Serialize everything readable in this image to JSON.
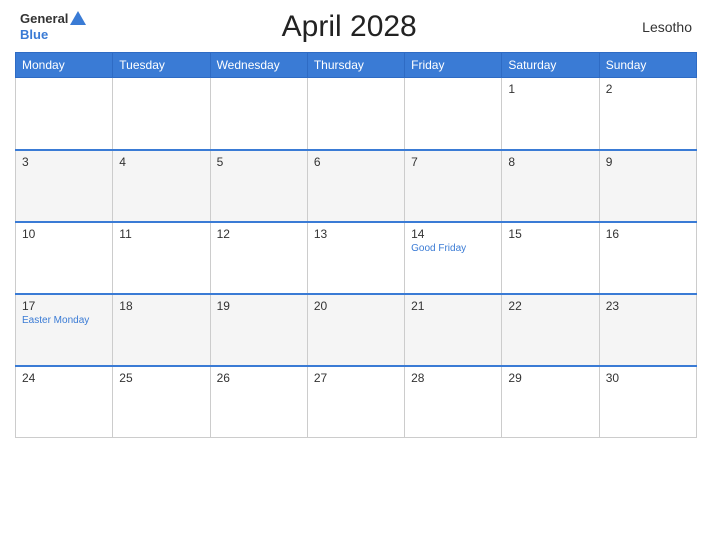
{
  "header": {
    "title": "April 2028",
    "country": "Lesotho",
    "logo": {
      "general": "General",
      "blue": "Blue"
    }
  },
  "days_of_week": [
    "Monday",
    "Tuesday",
    "Wednesday",
    "Thursday",
    "Friday",
    "Saturday",
    "Sunday"
  ],
  "weeks": [
    [
      {
        "day": "",
        "holiday": ""
      },
      {
        "day": "",
        "holiday": ""
      },
      {
        "day": "",
        "holiday": ""
      },
      {
        "day": "",
        "holiday": ""
      },
      {
        "day": "",
        "holiday": ""
      },
      {
        "day": "1",
        "holiday": ""
      },
      {
        "day": "2",
        "holiday": ""
      }
    ],
    [
      {
        "day": "3",
        "holiday": ""
      },
      {
        "day": "4",
        "holiday": ""
      },
      {
        "day": "5",
        "holiday": ""
      },
      {
        "day": "6",
        "holiday": ""
      },
      {
        "day": "7",
        "holiday": ""
      },
      {
        "day": "8",
        "holiday": ""
      },
      {
        "day": "9",
        "holiday": ""
      }
    ],
    [
      {
        "day": "10",
        "holiday": ""
      },
      {
        "day": "11",
        "holiday": ""
      },
      {
        "day": "12",
        "holiday": ""
      },
      {
        "day": "13",
        "holiday": ""
      },
      {
        "day": "14",
        "holiday": "Good Friday"
      },
      {
        "day": "15",
        "holiday": ""
      },
      {
        "day": "16",
        "holiday": ""
      }
    ],
    [
      {
        "day": "17",
        "holiday": "Easter Monday"
      },
      {
        "day": "18",
        "holiday": ""
      },
      {
        "day": "19",
        "holiday": ""
      },
      {
        "day": "20",
        "holiday": ""
      },
      {
        "day": "21",
        "holiday": ""
      },
      {
        "day": "22",
        "holiday": ""
      },
      {
        "day": "23",
        "holiday": ""
      }
    ],
    [
      {
        "day": "24",
        "holiday": ""
      },
      {
        "day": "25",
        "holiday": ""
      },
      {
        "day": "26",
        "holiday": ""
      },
      {
        "day": "27",
        "holiday": ""
      },
      {
        "day": "28",
        "holiday": ""
      },
      {
        "day": "29",
        "holiday": ""
      },
      {
        "day": "30",
        "holiday": ""
      }
    ]
  ]
}
